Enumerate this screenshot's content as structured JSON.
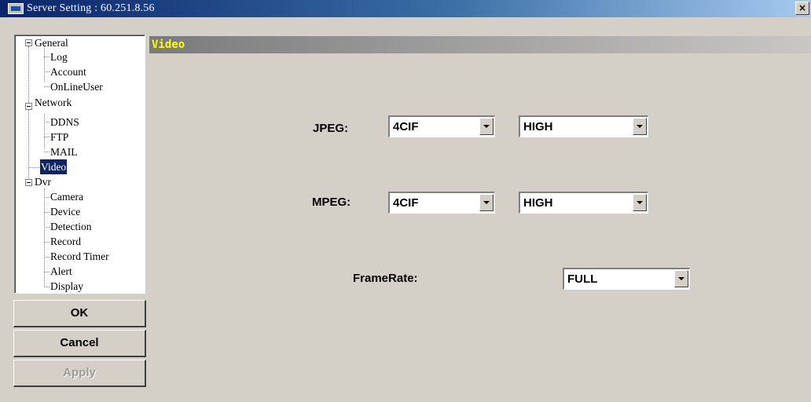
{
  "window": {
    "title": "Server Setting : 60.251.8.56",
    "close_label": "×"
  },
  "tree": {
    "groups": [
      {
        "label": "General",
        "children": [
          "Log",
          "Account",
          "OnLineUser"
        ]
      },
      {
        "label": "Network",
        "children": [
          "DDNS",
          "FTP",
          "MAIL"
        ]
      },
      {
        "label": "Video",
        "children": [],
        "selected": true
      },
      {
        "label": "Dvr",
        "children": [
          "Camera",
          "Device",
          "Detection",
          "Record",
          "Record Timer",
          "Alert",
          "Display"
        ]
      }
    ]
  },
  "buttons": {
    "ok": "OK",
    "cancel": "Cancel",
    "apply": "Apply"
  },
  "section": {
    "title": "Video"
  },
  "video": {
    "jpeg": {
      "label": "JPEG:",
      "resolution": "4CIF",
      "quality": "HIGH"
    },
    "mpeg": {
      "label": "MPEG:",
      "resolution": "4CIF",
      "quality": "HIGH"
    },
    "framerate": {
      "label": "FrameRate:",
      "value": "FULL"
    }
  },
  "colors": {
    "titlebar_start": "#0a246a",
    "selection": "#0a246a",
    "section_title": "#ffff00",
    "window_bg": "#d4d0c8"
  }
}
